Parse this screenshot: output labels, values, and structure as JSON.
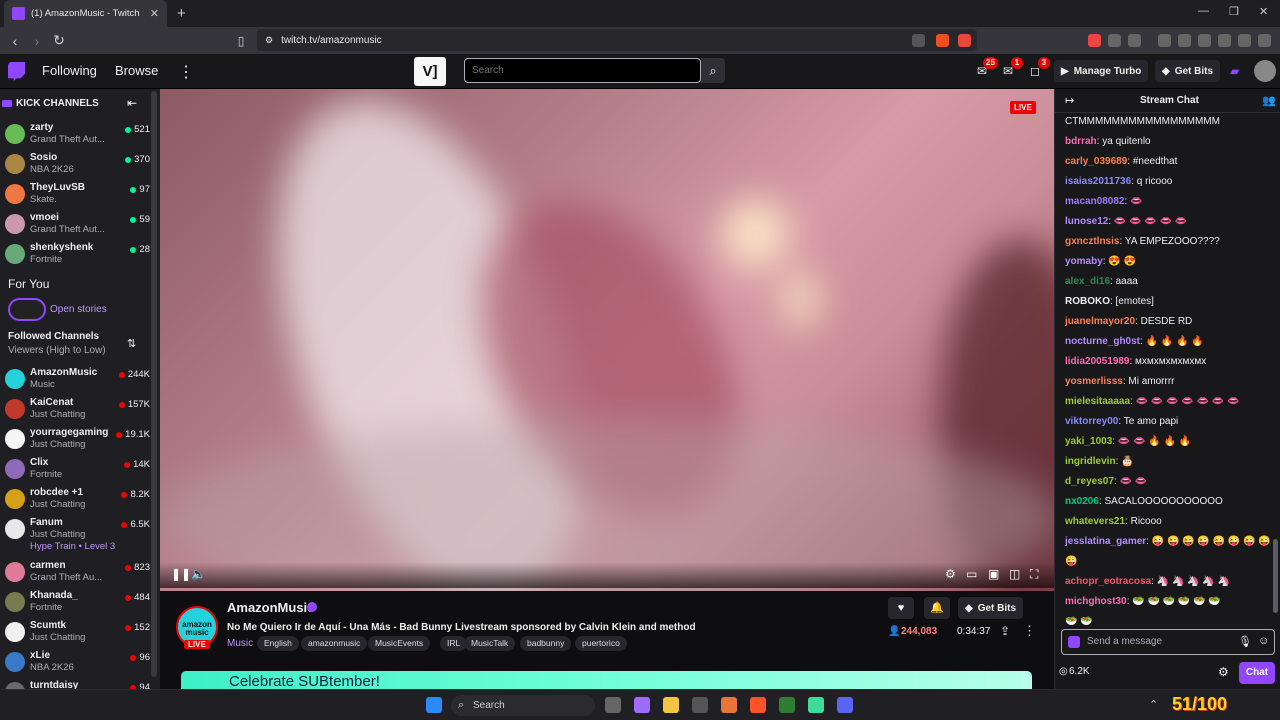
{
  "browser": {
    "tab_title": "(1) AmazonMusic - Twitch",
    "url": "twitch.tv/amazonmusic"
  },
  "topbar": {
    "following": "Following",
    "browse": "Browse",
    "search_placeholder": "Search",
    "badges": {
      "notifications": "25",
      "whispers": "1",
      "activity": "3"
    },
    "manage_turbo": "Manage Turbo",
    "get_bits": "Get Bits"
  },
  "sidebar": {
    "kick_title": "KICK CHANNELS",
    "kick_channels": [
      {
        "name": "zarty",
        "game": "Grand Theft Aut...",
        "count": "521"
      },
      {
        "name": "Sosio",
        "game": "NBA 2K26",
        "count": "370"
      },
      {
        "name": "TheyLuvSB",
        "game": "Skate.",
        "count": "97"
      },
      {
        "name": "vmoei",
        "game": "Grand Theft Aut...",
        "count": "59"
      },
      {
        "name": "shenkyshenk",
        "game": "Fortnite",
        "count": "28"
      }
    ],
    "for_you": "For You",
    "open_stories": "Open stories",
    "followed_title": "Followed Channels",
    "followed_sort": "Viewers (High to Low)",
    "followed": [
      {
        "name": "AmazonMusic",
        "game": "Music",
        "count": "244K",
        "color": "#25d1da"
      },
      {
        "name": "KaiCenat",
        "game": "Just Chatting",
        "count": "157K",
        "color": "#c0392b"
      },
      {
        "name": "yourragegaming",
        "game": "Just Chatting",
        "count": "19.1K",
        "color": "#f5f5f5"
      },
      {
        "name": "Clix",
        "game": "Fortnite",
        "count": "14K",
        "color": "#8e6ab8"
      },
      {
        "name": "robcdee +1",
        "game": "Just Chatting",
        "count": "8.2K",
        "color": "#d4a017"
      },
      {
        "name": "Fanum",
        "game": "Just Chatting",
        "count": "6.5K",
        "color": "#e8e8e8",
        "hype": "Hype Train • Level 3"
      },
      {
        "name": "carmen",
        "game": "Grand Theft Au...",
        "count": "823",
        "color": "#e07a9a"
      },
      {
        "name": "Khanada_",
        "game": "Fortnite",
        "count": "484",
        "color": "#7a7a50"
      },
      {
        "name": "Scumtk",
        "game": "Just Chatting",
        "count": "152",
        "color": "#f0f0f0"
      },
      {
        "name": "xLie",
        "game": "NBA 2K26",
        "count": "96",
        "color": "#3a78c8"
      },
      {
        "name": "turntdaisy",
        "game": "",
        "count": "94",
        "color": "#6a6a70"
      }
    ]
  },
  "video": {
    "live": "LIVE"
  },
  "stream": {
    "channel": "AmazonMusic",
    "avatar_text": "amazon music",
    "live": "LIVE",
    "title": "No Me Quiero Ir de Aquí - Una Más - Bad Bunny Livestream sponsored by Calvin Klein and method",
    "category": "Music",
    "tags": [
      "English",
      "amazonmusic",
      "MusicEvents",
      "IRL",
      "MusicTalk",
      "badbunny",
      "puertorico"
    ],
    "get_bits": "Get Bits",
    "viewers": "244,083",
    "uptime": "0:34:37",
    "banner": "Celebrate SUBtember!"
  },
  "chat": {
    "title": "Stream Chat",
    "messages": [
      {
        "user": "",
        "color": "#efeff1",
        "text": "CTMMMMMMMMMMMMMMMMM"
      },
      {
        "user": "bdrrah",
        "color": "#ff69b4",
        "text": ": ya quitenlo"
      },
      {
        "user": "carly_039689",
        "color": "#ff7f50",
        "text": ": #needthat"
      },
      {
        "user": "isaias2011736",
        "color": "#8a8aff",
        "text": ": q ricooo"
      },
      {
        "user": "macan08082",
        "color": "#9b7bff",
        "text": ": 👄"
      },
      {
        "user": "lunose12",
        "color": "#b28bff",
        "text": ": 👄 👄 👄 👄 👄"
      },
      {
        "user": "gxncztlnsis",
        "color": "#ff7f50",
        "text": ": YA EMPEZOOO????"
      },
      {
        "user": "yomaby",
        "color": "#b28bff",
        "text": ": 😍 😍"
      },
      {
        "user": "alex_di16",
        "color": "#2e8b57",
        "text": ": aaaa"
      },
      {
        "user": "ROBOKO",
        "color": "#efeff1",
        "text": ": [emotes]"
      },
      {
        "user": "juanelmayor20",
        "color": "#ff7f50",
        "text": ": DESDE RD"
      },
      {
        "user": "nocturne_gh0st",
        "color": "#b28bff",
        "text": ": 🔥 🔥 🔥 🔥"
      },
      {
        "user": "lidia20051989",
        "color": "#ff69b4",
        "text": ": мхмхмхмхмхмх"
      },
      {
        "user": "yosmerlisss",
        "color": "#ff7f50",
        "text": ": Mi amorrrr"
      },
      {
        "user": "mielesitaaaaa",
        "color": "#9acd32",
        "text": ": 👄 👄 👄 👄 👄 👄 👄"
      },
      {
        "user": "viktorrey00",
        "color": "#8a8aff",
        "text": ": Te amo papi"
      },
      {
        "user": "yaki_1003",
        "color": "#9acd32",
        "text": ": 👄 👄 🔥 🔥 🔥"
      },
      {
        "user": "ingridlevin",
        "color": "#9acd32",
        "text": ": 🎂"
      },
      {
        "user": "d_reyes07",
        "color": "#9acd32",
        "text": ": 👄 👄"
      },
      {
        "user": "nx0206",
        "color": "#00c878",
        "text": ": SACALOOOOOOOOOOO"
      },
      {
        "user": "whatevers21",
        "color": "#9acd32",
        "text": ": Ricooo"
      },
      {
        "user": "jesslatina_gamer",
        "color": "#b28bff",
        "text": ": 😜 😜 😜 😜 😜 😜 😜 😜"
      },
      {
        "user": "",
        "color": "#efeff1",
        "text": "😜"
      },
      {
        "user": "achopr_eotracosa",
        "color": "#ff4d6d",
        "text": ": 🦄 🦄 🦄 🦄 🦄"
      },
      {
        "user": "michghost30",
        "color": "#ff69b4",
        "text": ": 🥗 🥗 🥗 🥗 🥗 🥗"
      },
      {
        "user": "",
        "color": "#efeff1",
        "text": "🥗 🥗"
      }
    ],
    "input_placeholder": "Send a message",
    "points": "6.2K",
    "chat_button": "Chat"
  },
  "taskbar": {
    "search": "Search",
    "widget": "51/100"
  }
}
